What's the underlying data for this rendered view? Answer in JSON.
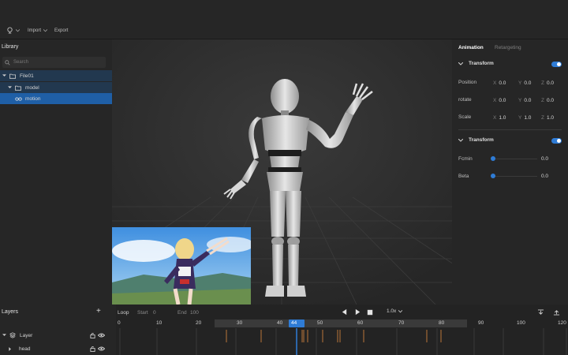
{
  "menubar": {
    "import_label": "Import",
    "export_label": "Export"
  },
  "library": {
    "title": "Library",
    "search_placeholder": "Search",
    "tree": [
      {
        "label": "File01"
      },
      {
        "label": "model"
      },
      {
        "label": "motion"
      }
    ]
  },
  "right_panel": {
    "tabs": [
      "Animation",
      "Retargeting"
    ],
    "transform": {
      "title": "Transform",
      "rows": [
        {
          "label": "Position",
          "x": "0.0",
          "y": "0.0",
          "z": "0.0"
        },
        {
          "label": "rotate",
          "x": "0.0",
          "y": "0.0",
          "z": "0.0"
        },
        {
          "label": "Scale",
          "x": "1.0",
          "y": "1.0",
          "z": "1.0"
        }
      ],
      "axes": [
        "X",
        "Y",
        "Z"
      ]
    },
    "transform2": {
      "title": "Transform",
      "sliders": [
        {
          "label": "Fcmin",
          "value": "0.0"
        },
        {
          "label": "Beta",
          "value": "0.0"
        }
      ]
    }
  },
  "layers": {
    "title": "Layers",
    "items": [
      {
        "label": "Layer"
      },
      {
        "label": "head"
      }
    ]
  },
  "timeline": {
    "loop_label": "Loop",
    "start_label": "Start",
    "start_value": "0",
    "end_label": "End",
    "end_value": "100",
    "speed": "1.0x",
    "ticks": [
      "0",
      "10",
      "20",
      "30",
      "40",
      "44",
      "50",
      "60",
      "70",
      "80",
      "90",
      "100",
      "120"
    ],
    "current_frame": "44"
  },
  "colors": {
    "accent": "#2f7cd6",
    "selected_row": "#1f5fa6",
    "keyframe": "#b8743a"
  }
}
